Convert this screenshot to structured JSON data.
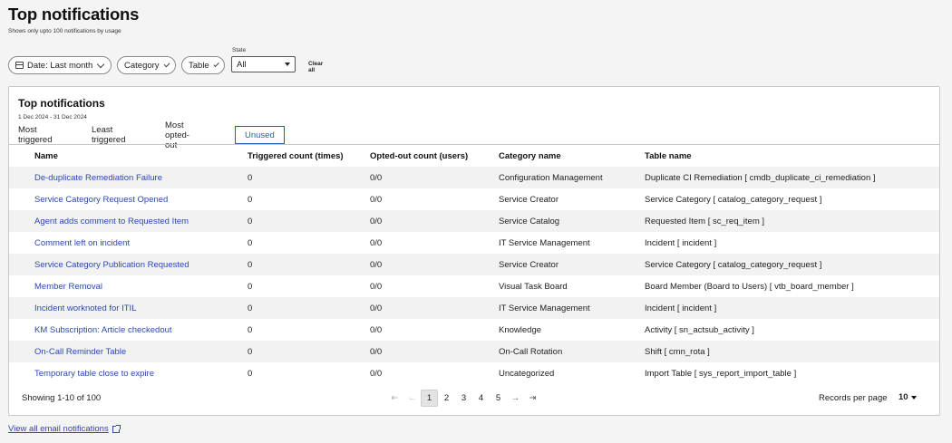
{
  "header": {
    "title": "Top notifications",
    "subtitle": "Shows only upto 100 notifications by usage"
  },
  "filters": {
    "date_label": "Date: Last month",
    "category_label": "Category",
    "table_label": "Table",
    "state_label": "State",
    "state_value": "All",
    "clear_all": "Clear all"
  },
  "card": {
    "title": "Top notifications",
    "date_range": "1 Dec 2024 - 31 Dec 2024",
    "tabs": [
      {
        "label": "Most triggered",
        "active": false
      },
      {
        "label": "Least triggered",
        "active": false
      },
      {
        "label": "Most opted-out",
        "active": false
      },
      {
        "label": "Unused",
        "active": true
      }
    ],
    "columns": [
      "Name",
      "Triggered count (times)",
      "Opted-out count (users)",
      "Category name",
      "Table name"
    ],
    "rows": [
      {
        "name": "De-duplicate Remediation Failure",
        "triggered": "0",
        "opted_out": "0/0",
        "category": "Configuration Management",
        "table": "Duplicate CI Remediation [ cmdb_duplicate_ci_remediation ]"
      },
      {
        "name": "Service Category Request Opened",
        "triggered": "0",
        "opted_out": "0/0",
        "category": "Service Creator",
        "table": "Service Category [ catalog_category_request ]"
      },
      {
        "name": "Agent adds comment to Requested Item",
        "triggered": "0",
        "opted_out": "0/0",
        "category": "Service Catalog",
        "table": "Requested Item [ sc_req_item ]"
      },
      {
        "name": "Comment left on incident",
        "triggered": "0",
        "opted_out": "0/0",
        "category": "IT Service Management",
        "table": "Incident [ incident ]"
      },
      {
        "name": "Service Category Publication Requested",
        "triggered": "0",
        "opted_out": "0/0",
        "category": "Service Creator",
        "table": "Service Category [ catalog_category_request ]"
      },
      {
        "name": "Member Removal",
        "triggered": "0",
        "opted_out": "0/0",
        "category": "Visual Task Board",
        "table": "Board Member (Board to Users) [ vtb_board_member ]"
      },
      {
        "name": "Incident worknoted for ITIL",
        "triggered": "0",
        "opted_out": "0/0",
        "category": "IT Service Management",
        "table": "Incident [ incident ]"
      },
      {
        "name": "KM Subscription: Article checkedout",
        "triggered": "0",
        "opted_out": "0/0",
        "category": "Knowledge",
        "table": "Activity [ sn_actsub_activity ]"
      },
      {
        "name": "On-Call Reminder Table",
        "triggered": "0",
        "opted_out": "0/0",
        "category": "On-Call Rotation",
        "table": "Shift [ cmn_rota ]"
      },
      {
        "name": "Temporary table close to expire",
        "triggered": "0",
        "opted_out": "0/0",
        "category": "Uncategorized",
        "table": "Import Table [ sys_report_import_table ]"
      }
    ],
    "footer": {
      "showing": "Showing 1-10 of 100",
      "pages": [
        "1",
        "2",
        "3",
        "4",
        "5"
      ],
      "current_page": "1",
      "records_per_page_label": "Records per page",
      "records_per_page_value": "10"
    }
  },
  "view_all_link": "View all email notifications",
  "colors": {
    "link": "#2b4aa8",
    "active_tab": "#1f5fa8",
    "stripe": "#f2f2f2"
  }
}
